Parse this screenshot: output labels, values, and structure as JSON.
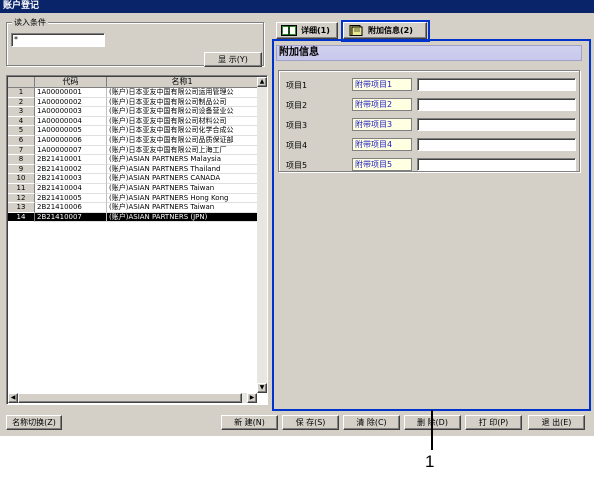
{
  "window": {
    "title": "账户登记"
  },
  "filter": {
    "group_label": "读入条件",
    "value": "*",
    "show_button": "显 示(Y)"
  },
  "grid": {
    "columns": [
      "",
      "代码",
      "名称1"
    ],
    "rows": [
      {
        "no": "1",
        "code": "1A00000001",
        "name": "(账户)日本亚友中国有限公司运用管理公"
      },
      {
        "no": "2",
        "code": "1A00000002",
        "name": "(账户)日本亚友中国有限公司制品公司"
      },
      {
        "no": "3",
        "code": "1A00000003",
        "name": "(账户)日本亚友中国有限公司设备营业公"
      },
      {
        "no": "4",
        "code": "1A00000004",
        "name": "(账户)日本亚友中国有限公司材料公司"
      },
      {
        "no": "5",
        "code": "1A00000005",
        "name": "(账户)日本亚友中国有限公司化学合成公"
      },
      {
        "no": "6",
        "code": "1A00000006",
        "name": "(账户)日本亚友中国有限公司品质保证部"
      },
      {
        "no": "7",
        "code": "1A00000007",
        "name": "(账户)日本亚友中国有限公司上海工厂"
      },
      {
        "no": "8",
        "code": "2B21410001",
        "name": "(账户)ASIAN PARTNERS Malaysia"
      },
      {
        "no": "9",
        "code": "2B21410002",
        "name": "(账户)ASIAN PARTNERS Thailand"
      },
      {
        "no": "10",
        "code": "2B21410003",
        "name": "(账户)ASIAN PARTNERS CANADA"
      },
      {
        "no": "11",
        "code": "2B21410004",
        "name": "(账户)ASIAN PARTNERS Taiwan"
      },
      {
        "no": "12",
        "code": "2B21410005",
        "name": "(账户)ASIAN PARTNERS Hong Kong"
      },
      {
        "no": "13",
        "code": "2B21410006",
        "name": "(账户)ASIAN PARTNERS Taiwan"
      },
      {
        "no": "14",
        "code": "2B21410007",
        "name": "(账户)ASIAN PARTNERS (JPN)"
      }
    ],
    "selected_row": "14"
  },
  "tabs": {
    "detail": "详细(1)",
    "extra": "附加信息(2)"
  },
  "panel": {
    "title": "附加信息",
    "fields": [
      {
        "label": "项目1",
        "name": "附带项目1",
        "value": ""
      },
      {
        "label": "项目2",
        "name": "附带项目2",
        "value": ""
      },
      {
        "label": "项目3",
        "name": "附带项目3",
        "value": ""
      },
      {
        "label": "项目4",
        "name": "附带项目4",
        "value": ""
      },
      {
        "label": "项目5",
        "name": "附带项目5",
        "value": ""
      }
    ]
  },
  "buttons": {
    "name_switch": "名称切换(Z)",
    "new": "新 建(N)",
    "save": "保 存(S)",
    "clear": "清 除(C)",
    "delete": "删 除(D)",
    "print": "打 印(P)",
    "exit": "退 出(E)"
  },
  "callout": {
    "number": "1"
  },
  "colors": {
    "title_bar": "#0a246a",
    "highlight": "#0033cc",
    "panel_title": "#c8c8ec",
    "field_name_bg": "#ffffe1"
  },
  "icons": {
    "detail_tab": "book-icon",
    "extra_tab": "notes-icon"
  }
}
